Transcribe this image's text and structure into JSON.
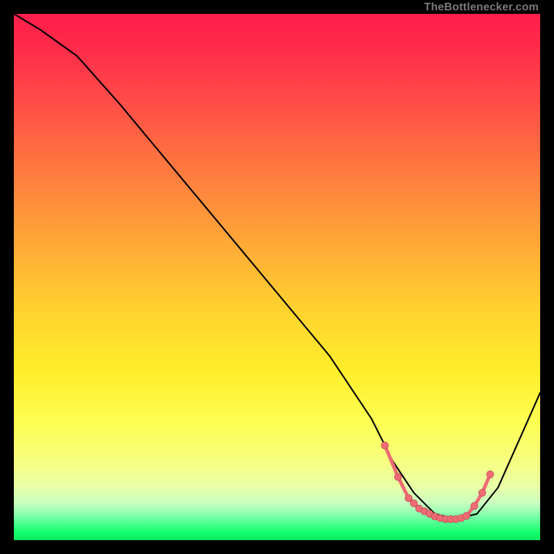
{
  "attribution": "TheBottlenecker.com",
  "chart_data": {
    "type": "line",
    "title": "",
    "xlabel": "",
    "ylabel": "",
    "xlim": [
      0,
      100
    ],
    "ylim": [
      0,
      100
    ],
    "series": [
      {
        "name": "curve",
        "x": [
          0,
          5,
          12,
          20,
          30,
          40,
          50,
          60,
          68,
          72,
          76,
          80,
          84,
          88,
          92,
          100
        ],
        "y": [
          100,
          97,
          92,
          83,
          71,
          59,
          47,
          35,
          23,
          15,
          9,
          5,
          4,
          5,
          10,
          28
        ]
      }
    ],
    "markers": {
      "x": [
        70.5,
        73.0,
        75.0,
        76.0,
        77.0,
        78.0,
        79.0,
        80.0,
        81.0,
        82.0,
        83.0,
        84.0,
        85.0,
        86.0,
        87.5,
        89.0,
        90.5
      ],
      "y": [
        18.0,
        12.0,
        8.0,
        7.0,
        6.0,
        5.5,
        5.0,
        4.5,
        4.2,
        4.0,
        4.0,
        4.0,
        4.2,
        4.6,
        6.5,
        9.0,
        12.5
      ]
    },
    "colors": {
      "curve": "#000000",
      "marker_fill": "#ef6b73",
      "marker_stroke": "#b34750"
    }
  }
}
